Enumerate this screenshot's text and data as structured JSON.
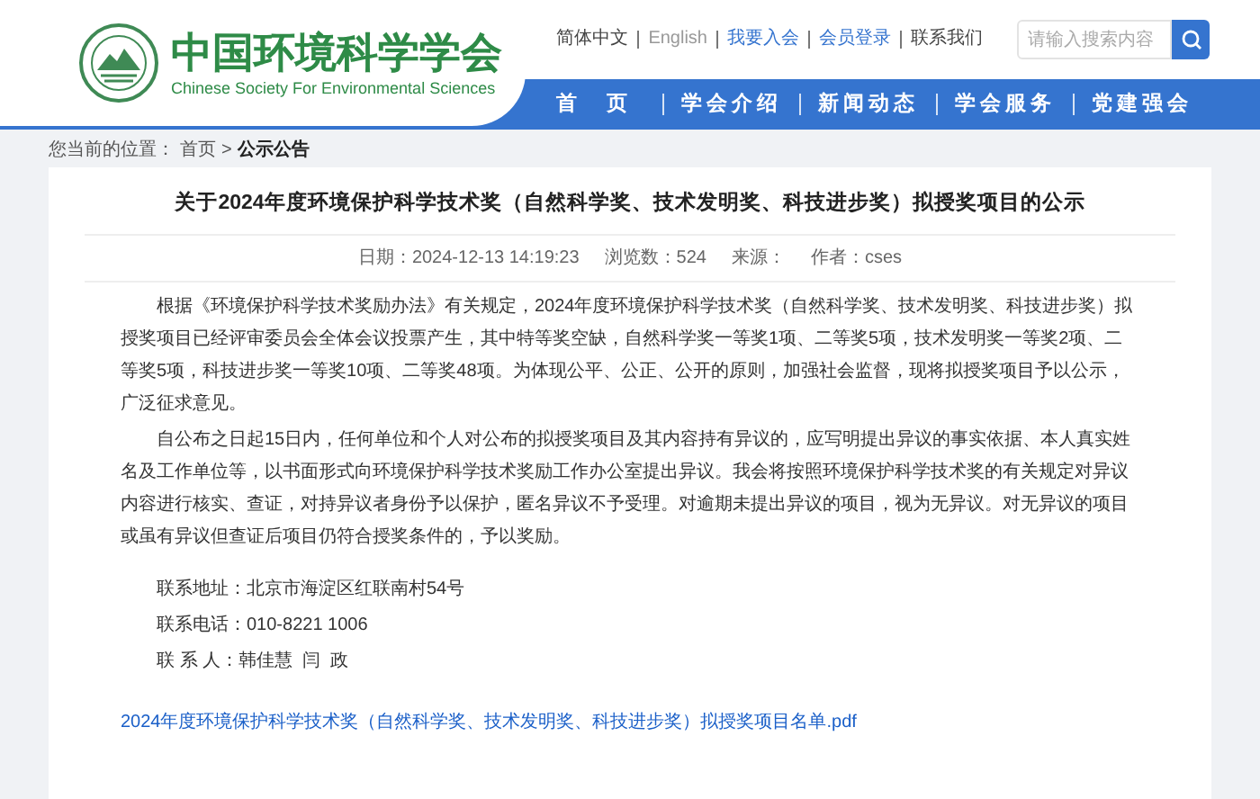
{
  "header": {
    "title": "中国环境科学学会",
    "subtitle": "Chinese Society For Environmental Sciences",
    "top_links": [
      {
        "label": "简体中文",
        "kind": "plain"
      },
      {
        "label": "English",
        "kind": "muted"
      },
      {
        "label": "我要入会",
        "kind": "link"
      },
      {
        "label": "会员登录",
        "kind": "link"
      },
      {
        "label": "联系我们",
        "kind": "plain"
      }
    ],
    "search": {
      "placeholder": "请输入搜索内容"
    }
  },
  "nav": [
    {
      "label": "首　页"
    },
    {
      "label": "学会介绍"
    },
    {
      "label": "新闻动态"
    },
    {
      "label": "学会服务"
    },
    {
      "label": "党建强会"
    }
  ],
  "breadcrumb": {
    "prefix": "您当前的位置：",
    "separator": ">",
    "items": [
      {
        "label": "首页",
        "current": false
      },
      {
        "label": "公示公告",
        "current": true
      }
    ]
  },
  "article": {
    "title": "关于2024年度环境保护科学技术奖（自然科学奖、技术发明奖、科技进步奖）拟授奖项目的公示",
    "meta": [
      "日期：2024-12-13 14:19:23",
      "浏览数：524",
      "来源：",
      "作者：cses"
    ],
    "paragraphs": [
      "根据《环境保护科学技术奖励办法》有关规定，2024年度环境保护科学技术奖（自然科学奖、技术发明奖、科技进步奖）拟授奖项目已经评审委员会全体会议投票产生，其中特等奖空缺，自然科学奖一等奖1项、二等奖5项，技术发明奖一等奖2项、二等奖5项，科技进步奖一等奖10项、二等奖48项。为体现公平、公正、公开的原则，加强社会监督，现将拟授奖项目予以公示，广泛征求意见。",
      "自公布之日起15日内，任何单位和个人对公布的拟授奖项目及其内容持有异议的，应写明提出异议的事实依据、本人真实姓名及工作单位等，以书面形式向环境保护科学技术奖励工作办公室提出异议。我会将按照环境保护科学技术奖的有关规定对异议内容进行核实、查证，对持异议者身份予以保护，匿名异议不予受理。对逾期未提出异议的项目，视为无异议。对无异议的项目或虽有异议但查证后项目仍符合授奖条件的，予以奖励。"
    ],
    "contacts": [
      "联系地址：北京市海淀区红联南村54号",
      "联系电话：010-8221 1006",
      "联 系 人：韩佳慧  闫  政"
    ],
    "attachment": "2024年度环境保护科学技术奖（自然科学奖、技术发明奖、科技进步奖）拟授奖项目名单.pdf"
  }
}
